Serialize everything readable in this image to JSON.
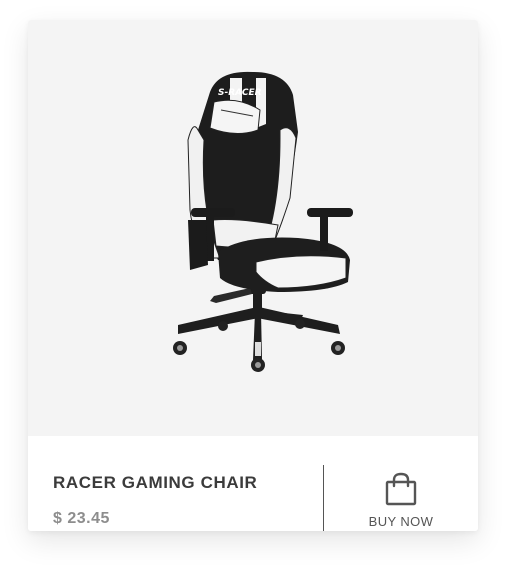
{
  "product": {
    "name": "RACER GAMING CHAIR",
    "price": "$ 23.45",
    "image_alt": "racer-gaming-chair-image",
    "brand_mark": "S-RACER"
  },
  "actions": {
    "buy_label": "BUY NOW",
    "buy_icon": "shopping-bag-icon"
  }
}
